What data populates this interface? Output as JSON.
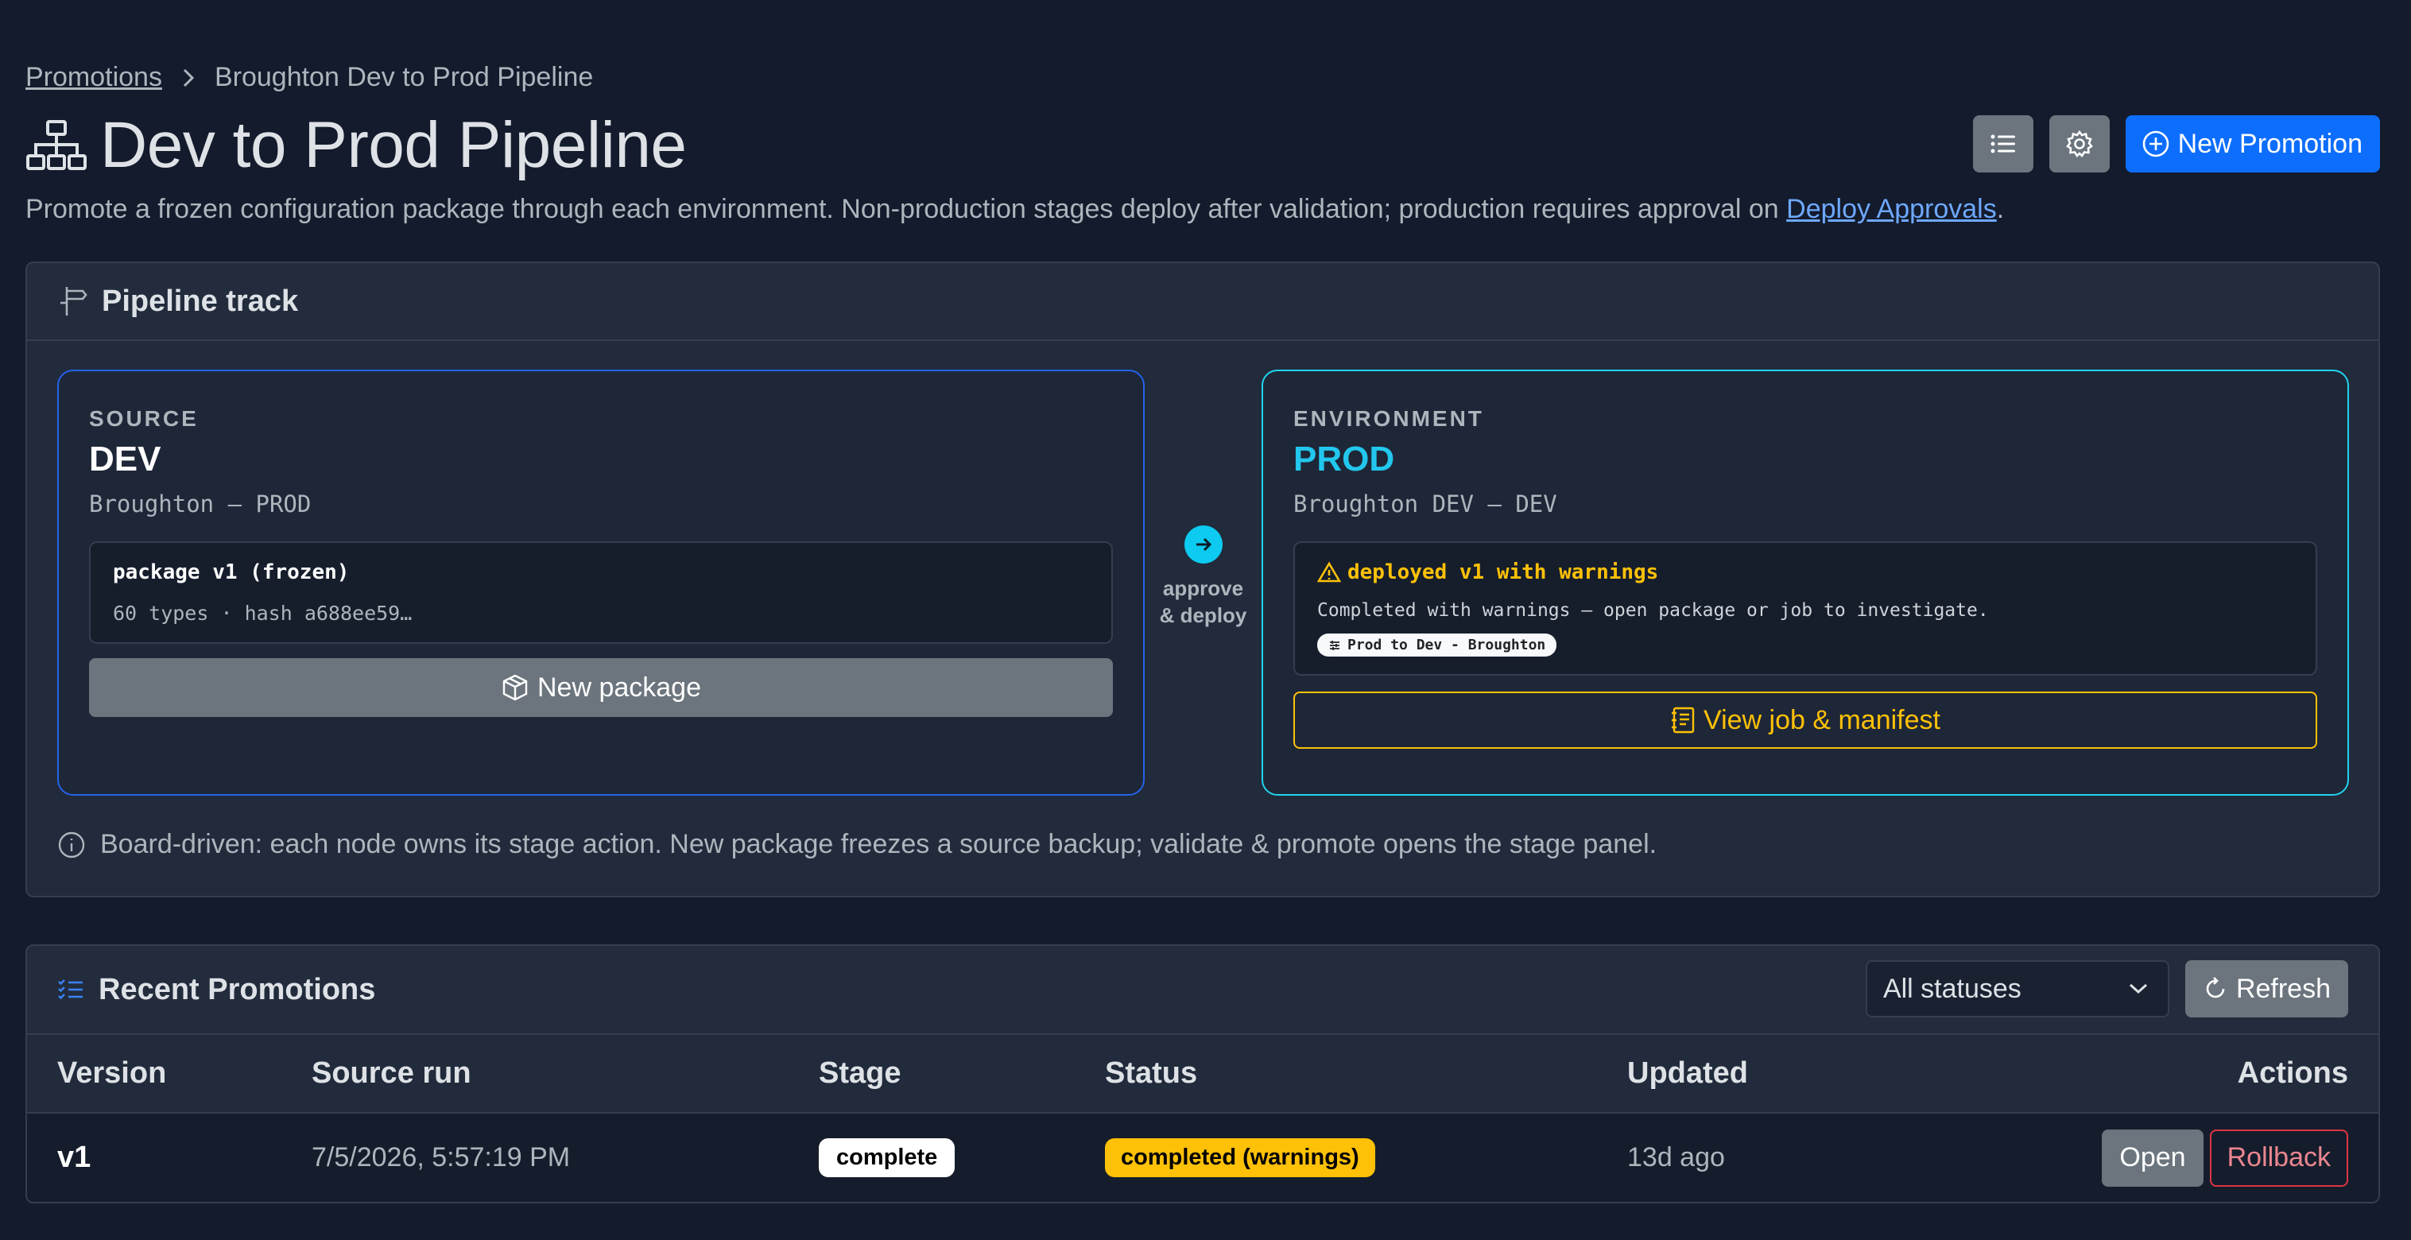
{
  "breadcrumb": {
    "root": "Promotions",
    "current": "Broughton Dev to Prod Pipeline"
  },
  "header": {
    "title": "Dev to Prod Pipeline",
    "new_promotion_label": "New Promotion",
    "subtitle_prefix": "Promote a frozen configuration package through each environment. Non-production stages deploy after validation; production requires approval on ",
    "subtitle_link": "Deploy Approvals",
    "subtitle_suffix": "."
  },
  "pipeline": {
    "title": "Pipeline track",
    "source": {
      "label": "SOURCE",
      "name": "DEV",
      "sub": "Broughton — PROD",
      "package_title": "package v1 (frozen)",
      "package_meta": "60 types · hash a688ee59…",
      "new_package_label": "New package"
    },
    "connector": {
      "line1": "approve",
      "line2": "& deploy"
    },
    "environment": {
      "label": "ENVIRONMENT",
      "name": "PROD",
      "sub": "Broughton DEV — DEV",
      "warn_title": "deployed v1 with warnings",
      "warn_text": "Completed with warnings — open package or job to investigate.",
      "chip": "Prod to Dev - Broughton",
      "view_job_label": "View job & manifest"
    },
    "note": "Board-driven: each node owns its stage action. New package freezes a source backup; validate & promote opens the stage panel."
  },
  "recent": {
    "title": "Recent Promotions",
    "filter_value": "All statuses",
    "refresh_label": "Refresh",
    "columns": [
      "Version",
      "Source run",
      "Stage",
      "Status",
      "Updated",
      "Actions"
    ],
    "rows": [
      {
        "version": "v1",
        "source_run": "7/5/2026, 5:57:19 PM",
        "stage": "complete",
        "status": "completed (warnings)",
        "updated": "13d ago",
        "open_label": "Open",
        "rollback_label": "Rollback"
      }
    ]
  },
  "colors": {
    "background": "#131b2c",
    "primary": "#0d6efd",
    "source_border": "#2563eb",
    "env_accent": "#22d3ee",
    "warning": "#ffc107",
    "danger": "#dc3545"
  }
}
